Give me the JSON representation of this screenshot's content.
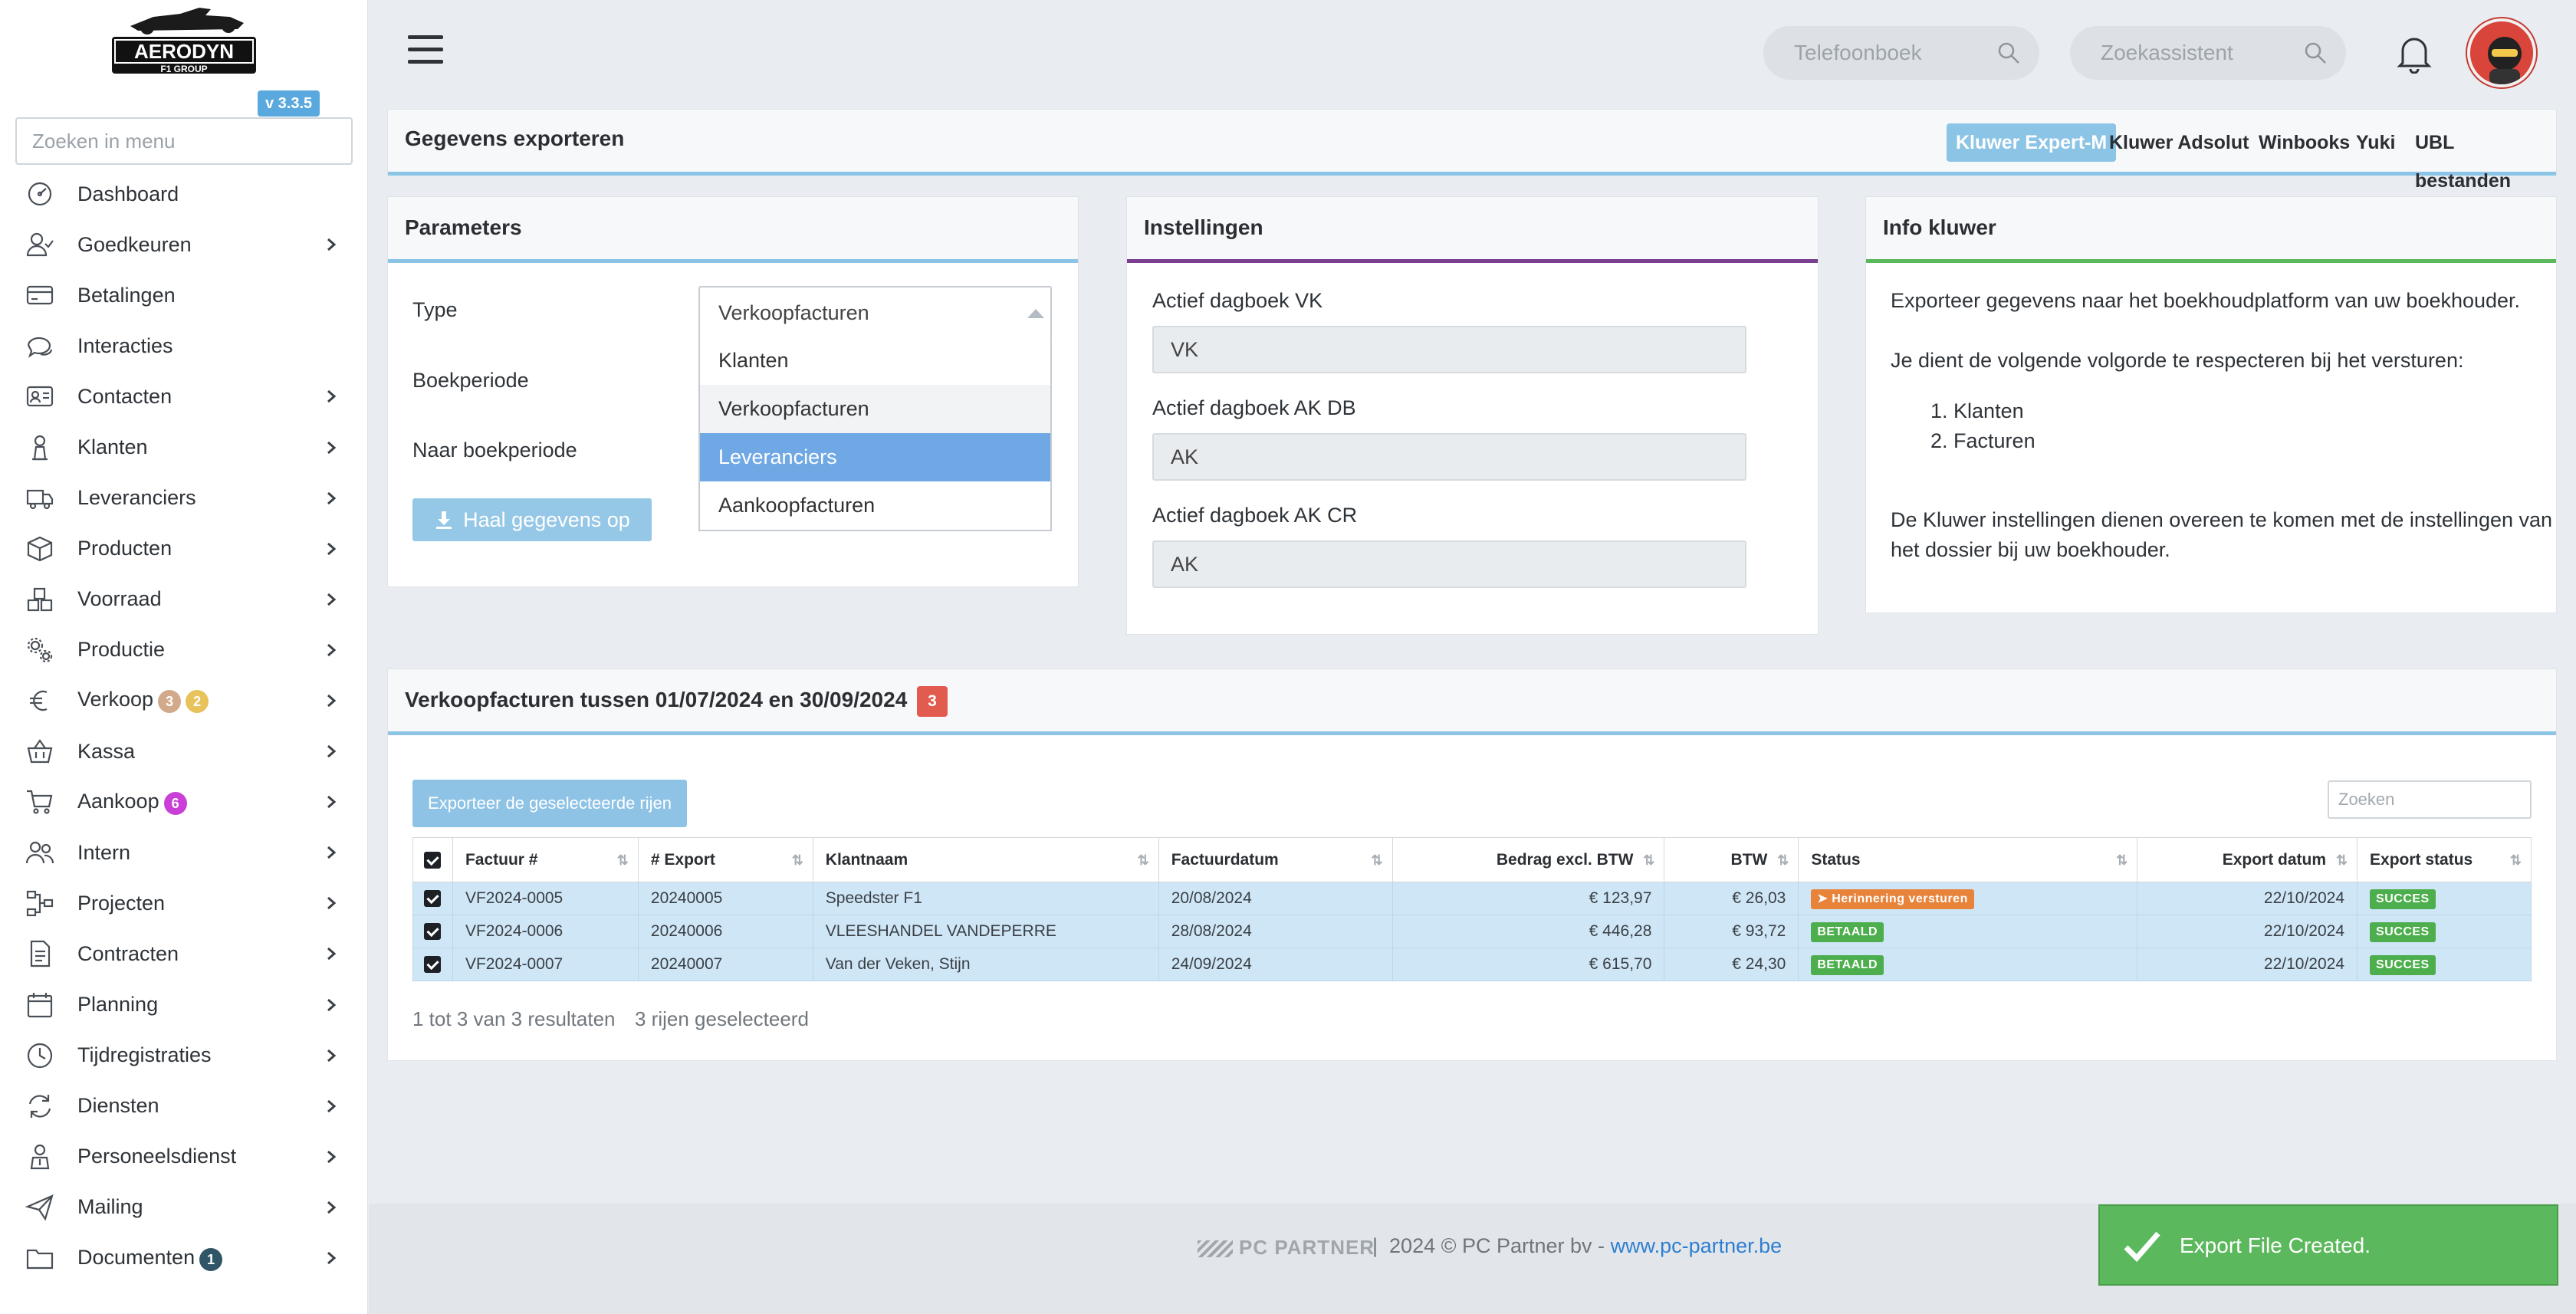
{
  "sidebar": {
    "logo_text": "AERODYN",
    "logo_subtext": "F1 GROUP",
    "version": "v 3.3.5",
    "search_placeholder": "Zoeken in menu",
    "items": [
      {
        "label": "Dashboard",
        "icon": "dashboard-icon",
        "chevron": false
      },
      {
        "label": "Goedkeuren",
        "icon": "user-check-icon",
        "chevron": true
      },
      {
        "label": "Betalingen",
        "icon": "credit-card-icon",
        "chevron": false
      },
      {
        "label": "Interacties",
        "icon": "chat-icon",
        "chevron": false
      },
      {
        "label": "Contacten",
        "icon": "id-card-icon",
        "chevron": true
      },
      {
        "label": "Klanten",
        "icon": "person-icon",
        "chevron": true
      },
      {
        "label": "Leveranciers",
        "icon": "truck-icon",
        "chevron": true
      },
      {
        "label": "Producten",
        "icon": "box-icon",
        "chevron": true
      },
      {
        "label": "Voorraad",
        "icon": "boxes-icon",
        "chevron": true
      },
      {
        "label": "Productie",
        "icon": "gears-icon",
        "chevron": true
      },
      {
        "label": "Verkoop",
        "icon": "euro-icon",
        "chevron": true,
        "badges": [
          {
            "text": "3",
            "color": "#d2a98a"
          },
          {
            "text": "2",
            "color": "#e8c25a"
          }
        ]
      },
      {
        "label": "Kassa",
        "icon": "basket-icon",
        "chevron": true
      },
      {
        "label": "Aankoop",
        "icon": "cart-icon",
        "chevron": true,
        "badges": [
          {
            "text": "6",
            "color": "#c93fd8"
          }
        ]
      },
      {
        "label": "Intern",
        "icon": "users-icon",
        "chevron": true
      },
      {
        "label": "Projecten",
        "icon": "flow-icon",
        "chevron": true
      },
      {
        "label": "Contracten",
        "icon": "document-icon",
        "chevron": true
      },
      {
        "label": "Planning",
        "icon": "calendar-icon",
        "chevron": true
      },
      {
        "label": "Tijdregistraties",
        "icon": "clock-icon",
        "chevron": true
      },
      {
        "label": "Diensten",
        "icon": "refresh-icon",
        "chevron": true
      },
      {
        "label": "Personeelsdienst",
        "icon": "person-badge-icon",
        "chevron": true
      },
      {
        "label": "Mailing",
        "icon": "send-icon",
        "chevron": true
      },
      {
        "label": "Documenten",
        "icon": "folder-icon",
        "chevron": true,
        "badges": [
          {
            "text": "1",
            "color": "#2f5566"
          }
        ]
      }
    ]
  },
  "topbar": {
    "phonebook_placeholder": "Telefoonboek",
    "assistant_placeholder": "Zoekassistent"
  },
  "export_header": {
    "title": "Gegevens exporteren",
    "tabs": [
      "Kluwer Expert-M",
      "Kluwer Adsolut",
      "Winbooks",
      "Yuki",
      "UBL bestanden"
    ],
    "active_tab": "Kluwer Expert-M"
  },
  "parameters": {
    "title": "Parameters",
    "type_label": "Type",
    "type_value": "Verkoopfacturen",
    "period_label": "Boekperiode",
    "to_period_label": "Naar boekperiode",
    "fetch_button": "Haal gegevens op",
    "dropdown_options": [
      "Klanten",
      "Verkoopfacturen",
      "Leveranciers",
      "Aankoopfacturen"
    ]
  },
  "settings": {
    "title": "Instellingen",
    "vk_label": "Actief dagboek VK",
    "vk_value": "VK",
    "akdb_label": "Actief dagboek AK DB",
    "akdb_value": "AK",
    "akcr_label": "Actief dagboek AK CR",
    "akcr_value": "AK"
  },
  "info": {
    "title": "Info kluwer",
    "p1": "Exporteer gegevens naar het boekhoudplatform van uw boekhouder.",
    "p2": "Je dient de volgende volgorde te respecteren bij het versturen:",
    "list": [
      "Klanten",
      "Facturen"
    ],
    "p3a": "De Kluwer instellingen dienen overeen te komen met de instellingen van",
    "p3b": "het dossier bij uw boekhouder."
  },
  "invoices": {
    "title": "Verkoopfacturen tussen 01/07/2024 en 30/09/2024",
    "count": "3",
    "export_button": "Exporteer de geselecteerde rijen",
    "search_placeholder": "Zoeken",
    "columns": [
      "Factuur #",
      "# Export",
      "Klantnaam",
      "Factuurdatum",
      "Bedrag excl. BTW",
      "BTW",
      "Status",
      "Export datum",
      "Export status"
    ],
    "rows": [
      {
        "factuur": "VF2024-0005",
        "export": "20240005",
        "klant": "Speedster F1",
        "datum": "20/08/2024",
        "bedrag": "€ 123,97",
        "btw": "€ 26,03",
        "status": "Herinnering versturen",
        "status_color": "#e8833a",
        "export_datum": "22/10/2024",
        "export_status": "SUCCES"
      },
      {
        "factuur": "VF2024-0006",
        "export": "20240006",
        "klant": "VLEESHANDEL VANDEPERRE",
        "datum": "28/08/2024",
        "bedrag": "€ 446,28",
        "btw": "€ 93,72",
        "status": "BETAALD",
        "status_color": "#4cae4c",
        "export_datum": "22/10/2024",
        "export_status": "SUCCES"
      },
      {
        "factuur": "VF2024-0007",
        "export": "20240007",
        "klant": "Van der Veken, Stijn",
        "datum": "24/09/2024",
        "bedrag": "€ 615,70",
        "btw": "€ 24,30",
        "status": "BETAALD",
        "status_color": "#4cae4c",
        "export_datum": "22/10/2024",
        "export_status": "SUCCES"
      }
    ],
    "footer_results": "1 tot 3 van 3 resultaten",
    "footer_selected": "3 rijen geselecteerd"
  },
  "footer": {
    "brand": "PC PARTNER",
    "copyright": "2024 © PC Partner bv - ",
    "link": "www.pc-partner.be"
  },
  "toast": {
    "message": "Export File Created."
  }
}
